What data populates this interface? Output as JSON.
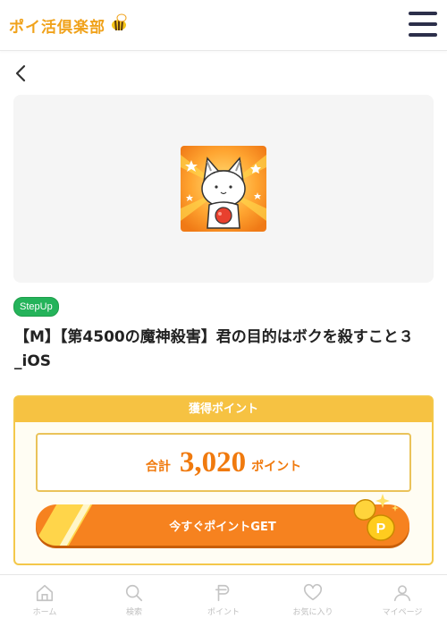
{
  "header": {
    "logo_text": "ポイ活倶楽部",
    "menu_icon": "hamburger-menu-icon"
  },
  "nav": {
    "back_icon": "chevron-left-icon"
  },
  "offer": {
    "tag": "StepUp",
    "title": "【M】【第4500の魔神殺害】君の目的はボクを殺すこと３_iOS",
    "icon": "cat-character-app-icon"
  },
  "points": {
    "header_label": "獲得ポイント",
    "total_label": "合計",
    "total_value": "3,020",
    "unit_label": "ポイント"
  },
  "cta": {
    "label": "今すぐポイントGET",
    "icon": "coins-icon"
  },
  "bottom_nav": {
    "items": [
      {
        "label": "ホーム",
        "icon": "home-icon"
      },
      {
        "label": "検索",
        "icon": "search-icon"
      },
      {
        "label": "ポイント",
        "icon": "point-p-icon"
      },
      {
        "label": "お気に入り",
        "icon": "heart-icon"
      },
      {
        "label": "マイページ",
        "icon": "person-icon"
      }
    ]
  },
  "colors": {
    "brand_orange": "#f6821f",
    "brand_yellow": "#f6c242",
    "tag_green": "#24b35a",
    "nav_dark": "#2c2f4a"
  }
}
